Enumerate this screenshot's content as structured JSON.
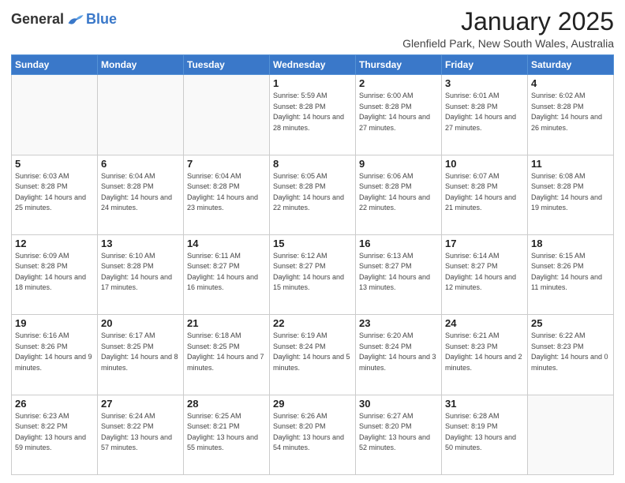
{
  "header": {
    "logo_general": "General",
    "logo_blue": "Blue",
    "month_title": "January 2025",
    "location": "Glenfield Park, New South Wales, Australia"
  },
  "weekdays": [
    "Sunday",
    "Monday",
    "Tuesday",
    "Wednesday",
    "Thursday",
    "Friday",
    "Saturday"
  ],
  "weeks": [
    [
      {
        "day": "",
        "sunrise": "",
        "sunset": "",
        "daylight": ""
      },
      {
        "day": "",
        "sunrise": "",
        "sunset": "",
        "daylight": ""
      },
      {
        "day": "",
        "sunrise": "",
        "sunset": "",
        "daylight": ""
      },
      {
        "day": "1",
        "sunrise": "Sunrise: 5:59 AM",
        "sunset": "Sunset: 8:28 PM",
        "daylight": "Daylight: 14 hours and 28 minutes."
      },
      {
        "day": "2",
        "sunrise": "Sunrise: 6:00 AM",
        "sunset": "Sunset: 8:28 PM",
        "daylight": "Daylight: 14 hours and 27 minutes."
      },
      {
        "day": "3",
        "sunrise": "Sunrise: 6:01 AM",
        "sunset": "Sunset: 8:28 PM",
        "daylight": "Daylight: 14 hours and 27 minutes."
      },
      {
        "day": "4",
        "sunrise": "Sunrise: 6:02 AM",
        "sunset": "Sunset: 8:28 PM",
        "daylight": "Daylight: 14 hours and 26 minutes."
      }
    ],
    [
      {
        "day": "5",
        "sunrise": "Sunrise: 6:03 AM",
        "sunset": "Sunset: 8:28 PM",
        "daylight": "Daylight: 14 hours and 25 minutes."
      },
      {
        "day": "6",
        "sunrise": "Sunrise: 6:04 AM",
        "sunset": "Sunset: 8:28 PM",
        "daylight": "Daylight: 14 hours and 24 minutes."
      },
      {
        "day": "7",
        "sunrise": "Sunrise: 6:04 AM",
        "sunset": "Sunset: 8:28 PM",
        "daylight": "Daylight: 14 hours and 23 minutes."
      },
      {
        "day": "8",
        "sunrise": "Sunrise: 6:05 AM",
        "sunset": "Sunset: 8:28 PM",
        "daylight": "Daylight: 14 hours and 22 minutes."
      },
      {
        "day": "9",
        "sunrise": "Sunrise: 6:06 AM",
        "sunset": "Sunset: 8:28 PM",
        "daylight": "Daylight: 14 hours and 22 minutes."
      },
      {
        "day": "10",
        "sunrise": "Sunrise: 6:07 AM",
        "sunset": "Sunset: 8:28 PM",
        "daylight": "Daylight: 14 hours and 21 minutes."
      },
      {
        "day": "11",
        "sunrise": "Sunrise: 6:08 AM",
        "sunset": "Sunset: 8:28 PM",
        "daylight": "Daylight: 14 hours and 19 minutes."
      }
    ],
    [
      {
        "day": "12",
        "sunrise": "Sunrise: 6:09 AM",
        "sunset": "Sunset: 8:28 PM",
        "daylight": "Daylight: 14 hours and 18 minutes."
      },
      {
        "day": "13",
        "sunrise": "Sunrise: 6:10 AM",
        "sunset": "Sunset: 8:28 PM",
        "daylight": "Daylight: 14 hours and 17 minutes."
      },
      {
        "day": "14",
        "sunrise": "Sunrise: 6:11 AM",
        "sunset": "Sunset: 8:27 PM",
        "daylight": "Daylight: 14 hours and 16 minutes."
      },
      {
        "day": "15",
        "sunrise": "Sunrise: 6:12 AM",
        "sunset": "Sunset: 8:27 PM",
        "daylight": "Daylight: 14 hours and 15 minutes."
      },
      {
        "day": "16",
        "sunrise": "Sunrise: 6:13 AM",
        "sunset": "Sunset: 8:27 PM",
        "daylight": "Daylight: 14 hours and 13 minutes."
      },
      {
        "day": "17",
        "sunrise": "Sunrise: 6:14 AM",
        "sunset": "Sunset: 8:27 PM",
        "daylight": "Daylight: 14 hours and 12 minutes."
      },
      {
        "day": "18",
        "sunrise": "Sunrise: 6:15 AM",
        "sunset": "Sunset: 8:26 PM",
        "daylight": "Daylight: 14 hours and 11 minutes."
      }
    ],
    [
      {
        "day": "19",
        "sunrise": "Sunrise: 6:16 AM",
        "sunset": "Sunset: 8:26 PM",
        "daylight": "Daylight: 14 hours and 9 minutes."
      },
      {
        "day": "20",
        "sunrise": "Sunrise: 6:17 AM",
        "sunset": "Sunset: 8:25 PM",
        "daylight": "Daylight: 14 hours and 8 minutes."
      },
      {
        "day": "21",
        "sunrise": "Sunrise: 6:18 AM",
        "sunset": "Sunset: 8:25 PM",
        "daylight": "Daylight: 14 hours and 7 minutes."
      },
      {
        "day": "22",
        "sunrise": "Sunrise: 6:19 AM",
        "sunset": "Sunset: 8:24 PM",
        "daylight": "Daylight: 14 hours and 5 minutes."
      },
      {
        "day": "23",
        "sunrise": "Sunrise: 6:20 AM",
        "sunset": "Sunset: 8:24 PM",
        "daylight": "Daylight: 14 hours and 3 minutes."
      },
      {
        "day": "24",
        "sunrise": "Sunrise: 6:21 AM",
        "sunset": "Sunset: 8:23 PM",
        "daylight": "Daylight: 14 hours and 2 minutes."
      },
      {
        "day": "25",
        "sunrise": "Sunrise: 6:22 AM",
        "sunset": "Sunset: 8:23 PM",
        "daylight": "Daylight: 14 hours and 0 minutes."
      }
    ],
    [
      {
        "day": "26",
        "sunrise": "Sunrise: 6:23 AM",
        "sunset": "Sunset: 8:22 PM",
        "daylight": "Daylight: 13 hours and 59 minutes."
      },
      {
        "day": "27",
        "sunrise": "Sunrise: 6:24 AM",
        "sunset": "Sunset: 8:22 PM",
        "daylight": "Daylight: 13 hours and 57 minutes."
      },
      {
        "day": "28",
        "sunrise": "Sunrise: 6:25 AM",
        "sunset": "Sunset: 8:21 PM",
        "daylight": "Daylight: 13 hours and 55 minutes."
      },
      {
        "day": "29",
        "sunrise": "Sunrise: 6:26 AM",
        "sunset": "Sunset: 8:20 PM",
        "daylight": "Daylight: 13 hours and 54 minutes."
      },
      {
        "day": "30",
        "sunrise": "Sunrise: 6:27 AM",
        "sunset": "Sunset: 8:20 PM",
        "daylight": "Daylight: 13 hours and 52 minutes."
      },
      {
        "day": "31",
        "sunrise": "Sunrise: 6:28 AM",
        "sunset": "Sunset: 8:19 PM",
        "daylight": "Daylight: 13 hours and 50 minutes."
      },
      {
        "day": "",
        "sunrise": "",
        "sunset": "",
        "daylight": ""
      }
    ]
  ]
}
